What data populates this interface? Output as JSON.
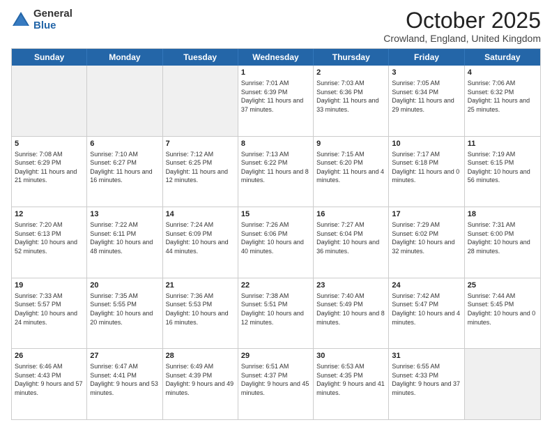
{
  "logo": {
    "general": "General",
    "blue": "Blue"
  },
  "title": "October 2025",
  "location": "Crowland, England, United Kingdom",
  "days": [
    "Sunday",
    "Monday",
    "Tuesday",
    "Wednesday",
    "Thursday",
    "Friday",
    "Saturday"
  ],
  "weeks": [
    [
      {
        "day": "",
        "sunrise": "",
        "sunset": "",
        "daylight": "",
        "empty": true
      },
      {
        "day": "",
        "sunrise": "",
        "sunset": "",
        "daylight": "",
        "empty": true
      },
      {
        "day": "",
        "sunrise": "",
        "sunset": "",
        "daylight": "",
        "empty": true
      },
      {
        "day": "1",
        "sunrise": "Sunrise: 7:01 AM",
        "sunset": "Sunset: 6:39 PM",
        "daylight": "Daylight: 11 hours and 37 minutes."
      },
      {
        "day": "2",
        "sunrise": "Sunrise: 7:03 AM",
        "sunset": "Sunset: 6:36 PM",
        "daylight": "Daylight: 11 hours and 33 minutes."
      },
      {
        "day": "3",
        "sunrise": "Sunrise: 7:05 AM",
        "sunset": "Sunset: 6:34 PM",
        "daylight": "Daylight: 11 hours and 29 minutes."
      },
      {
        "day": "4",
        "sunrise": "Sunrise: 7:06 AM",
        "sunset": "Sunset: 6:32 PM",
        "daylight": "Daylight: 11 hours and 25 minutes."
      }
    ],
    [
      {
        "day": "5",
        "sunrise": "Sunrise: 7:08 AM",
        "sunset": "Sunset: 6:29 PM",
        "daylight": "Daylight: 11 hours and 21 minutes."
      },
      {
        "day": "6",
        "sunrise": "Sunrise: 7:10 AM",
        "sunset": "Sunset: 6:27 PM",
        "daylight": "Daylight: 11 hours and 16 minutes."
      },
      {
        "day": "7",
        "sunrise": "Sunrise: 7:12 AM",
        "sunset": "Sunset: 6:25 PM",
        "daylight": "Daylight: 11 hours and 12 minutes."
      },
      {
        "day": "8",
        "sunrise": "Sunrise: 7:13 AM",
        "sunset": "Sunset: 6:22 PM",
        "daylight": "Daylight: 11 hours and 8 minutes."
      },
      {
        "day": "9",
        "sunrise": "Sunrise: 7:15 AM",
        "sunset": "Sunset: 6:20 PM",
        "daylight": "Daylight: 11 hours and 4 minutes."
      },
      {
        "day": "10",
        "sunrise": "Sunrise: 7:17 AM",
        "sunset": "Sunset: 6:18 PM",
        "daylight": "Daylight: 11 hours and 0 minutes."
      },
      {
        "day": "11",
        "sunrise": "Sunrise: 7:19 AM",
        "sunset": "Sunset: 6:15 PM",
        "daylight": "Daylight: 10 hours and 56 minutes."
      }
    ],
    [
      {
        "day": "12",
        "sunrise": "Sunrise: 7:20 AM",
        "sunset": "Sunset: 6:13 PM",
        "daylight": "Daylight: 10 hours and 52 minutes."
      },
      {
        "day": "13",
        "sunrise": "Sunrise: 7:22 AM",
        "sunset": "Sunset: 6:11 PM",
        "daylight": "Daylight: 10 hours and 48 minutes."
      },
      {
        "day": "14",
        "sunrise": "Sunrise: 7:24 AM",
        "sunset": "Sunset: 6:09 PM",
        "daylight": "Daylight: 10 hours and 44 minutes."
      },
      {
        "day": "15",
        "sunrise": "Sunrise: 7:26 AM",
        "sunset": "Sunset: 6:06 PM",
        "daylight": "Daylight: 10 hours and 40 minutes."
      },
      {
        "day": "16",
        "sunrise": "Sunrise: 7:27 AM",
        "sunset": "Sunset: 6:04 PM",
        "daylight": "Daylight: 10 hours and 36 minutes."
      },
      {
        "day": "17",
        "sunrise": "Sunrise: 7:29 AM",
        "sunset": "Sunset: 6:02 PM",
        "daylight": "Daylight: 10 hours and 32 minutes."
      },
      {
        "day": "18",
        "sunrise": "Sunrise: 7:31 AM",
        "sunset": "Sunset: 6:00 PM",
        "daylight": "Daylight: 10 hours and 28 minutes."
      }
    ],
    [
      {
        "day": "19",
        "sunrise": "Sunrise: 7:33 AM",
        "sunset": "Sunset: 5:57 PM",
        "daylight": "Daylight: 10 hours and 24 minutes."
      },
      {
        "day": "20",
        "sunrise": "Sunrise: 7:35 AM",
        "sunset": "Sunset: 5:55 PM",
        "daylight": "Daylight: 10 hours and 20 minutes."
      },
      {
        "day": "21",
        "sunrise": "Sunrise: 7:36 AM",
        "sunset": "Sunset: 5:53 PM",
        "daylight": "Daylight: 10 hours and 16 minutes."
      },
      {
        "day": "22",
        "sunrise": "Sunrise: 7:38 AM",
        "sunset": "Sunset: 5:51 PM",
        "daylight": "Daylight: 10 hours and 12 minutes."
      },
      {
        "day": "23",
        "sunrise": "Sunrise: 7:40 AM",
        "sunset": "Sunset: 5:49 PM",
        "daylight": "Daylight: 10 hours and 8 minutes."
      },
      {
        "day": "24",
        "sunrise": "Sunrise: 7:42 AM",
        "sunset": "Sunset: 5:47 PM",
        "daylight": "Daylight: 10 hours and 4 minutes."
      },
      {
        "day": "25",
        "sunrise": "Sunrise: 7:44 AM",
        "sunset": "Sunset: 5:45 PM",
        "daylight": "Daylight: 10 hours and 0 minutes."
      }
    ],
    [
      {
        "day": "26",
        "sunrise": "Sunrise: 6:46 AM",
        "sunset": "Sunset: 4:43 PM",
        "daylight": "Daylight: 9 hours and 57 minutes."
      },
      {
        "day": "27",
        "sunrise": "Sunrise: 6:47 AM",
        "sunset": "Sunset: 4:41 PM",
        "daylight": "Daylight: 9 hours and 53 minutes."
      },
      {
        "day": "28",
        "sunrise": "Sunrise: 6:49 AM",
        "sunset": "Sunset: 4:39 PM",
        "daylight": "Daylight: 9 hours and 49 minutes."
      },
      {
        "day": "29",
        "sunrise": "Sunrise: 6:51 AM",
        "sunset": "Sunset: 4:37 PM",
        "daylight": "Daylight: 9 hours and 45 minutes."
      },
      {
        "day": "30",
        "sunrise": "Sunrise: 6:53 AM",
        "sunset": "Sunset: 4:35 PM",
        "daylight": "Daylight: 9 hours and 41 minutes."
      },
      {
        "day": "31",
        "sunrise": "Sunrise: 6:55 AM",
        "sunset": "Sunset: 4:33 PM",
        "daylight": "Daylight: 9 hours and 37 minutes."
      },
      {
        "day": "",
        "sunrise": "",
        "sunset": "",
        "daylight": "",
        "empty": true
      }
    ]
  ]
}
